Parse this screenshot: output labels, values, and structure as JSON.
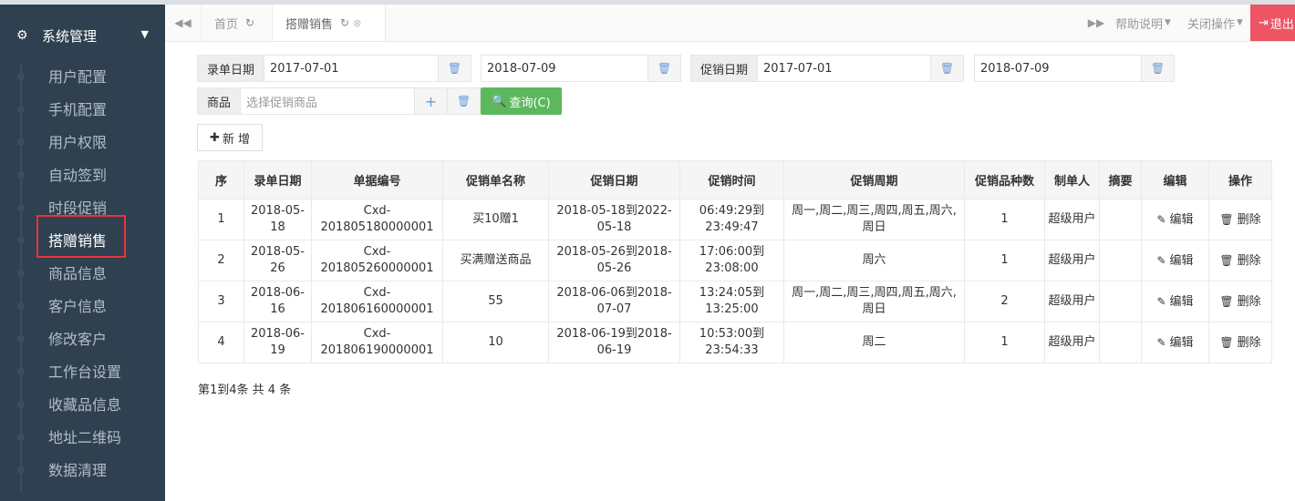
{
  "sidebar": {
    "title": "系统管理",
    "items": [
      {
        "label": "用户配置"
      },
      {
        "label": "手机配置"
      },
      {
        "label": "用户权限"
      },
      {
        "label": "自动签到"
      },
      {
        "label": "时段促销"
      },
      {
        "label": "搭赠销售"
      },
      {
        "label": "商品信息"
      },
      {
        "label": "客户信息"
      },
      {
        "label": "修改客户"
      },
      {
        "label": "工作台设置"
      },
      {
        "label": "收藏品信息"
      },
      {
        "label": "地址二维码"
      },
      {
        "label": "数据清理"
      }
    ],
    "active_index": 5
  },
  "tabs": {
    "home": "首页",
    "current": "搭赠销售",
    "help": "帮助说明",
    "close_ops": "关闭操作",
    "logout": "退出"
  },
  "filters": {
    "entry_date_label": "录单日期",
    "entry_date_from": "2017-07-01",
    "entry_date_to": "2018-07-09",
    "promo_date_label": "促销日期",
    "promo_date_from": "2017-07-01",
    "promo_date_to": "2018-07-09",
    "goods_label": "商品",
    "goods_placeholder": "选择促销商品",
    "query_label": "查询(C)",
    "add_label": "新 增"
  },
  "table": {
    "headers": [
      "序",
      "录单日期",
      "单据编号",
      "促销单名称",
      "促销日期",
      "促销时间",
      "促销周期",
      "促销品种数",
      "制单人",
      "摘要",
      "编辑",
      "操作"
    ],
    "edit_label": "编辑",
    "delete_label": "删除",
    "rows": [
      {
        "no": "1",
        "entry_date": "2018-05-18",
        "code": "Cxd-201805180000001",
        "name": "买10赠1",
        "promo_date": "2018-05-18到2022-05-18",
        "promo_time": "06:49:29到23:49:47",
        "cycle": "周一,周二,周三,周四,周五,周六,周日",
        "kinds": "1",
        "maker": "超级用户",
        "summary": ""
      },
      {
        "no": "2",
        "entry_date": "2018-05-26",
        "code": "Cxd-201805260000001",
        "name": "买满赠送商品",
        "promo_date": "2018-05-26到2018-05-26",
        "promo_time": "17:06:00到23:08:00",
        "cycle": "周六",
        "kinds": "1",
        "maker": "超级用户",
        "summary": ""
      },
      {
        "no": "3",
        "entry_date": "2018-06-16",
        "code": "Cxd-201806160000001",
        "name": "55",
        "promo_date": "2018-06-06到2018-07-07",
        "promo_time": "13:24:05到13:25:00",
        "cycle": "周一,周二,周三,周四,周五,周六,周日",
        "kinds": "2",
        "maker": "超级用户",
        "summary": ""
      },
      {
        "no": "4",
        "entry_date": "2018-06-19",
        "code": "Cxd-201806190000001",
        "name": "10",
        "promo_date": "2018-06-19到2018-06-19",
        "promo_time": "10:53:00到23:54:33",
        "cycle": "周二",
        "kinds": "1",
        "maker": "超级用户",
        "summary": ""
      }
    ]
  },
  "pager": {
    "text": "第1到4条 共 4 条"
  }
}
